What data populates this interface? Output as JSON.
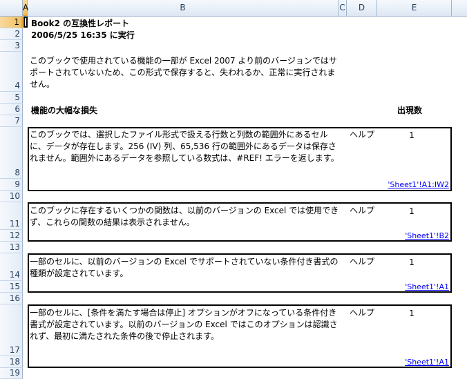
{
  "columns": [
    "A",
    "B",
    "C",
    "D",
    "E"
  ],
  "rows": [
    "1",
    "2",
    "3",
    "4",
    "5",
    "6",
    "7",
    "8",
    "9",
    "10",
    "11",
    "12",
    "13",
    "14",
    "15",
    "16",
    "17",
    "18",
    "19"
  ],
  "report": {
    "title": "Book2 の互換性レポート",
    "run_at": "2006/5/25 16:35 に実行",
    "intro": "このブックで使用されている機能の一部が Excel 2007 より前のバージョンではサポートされていないため、この形式で保存すると、失われるか、正常に実行されません。",
    "section_title": "機能の大幅な損失",
    "count_header": "出現数"
  },
  "issues": [
    {
      "desc": "このブックでは、選択したファイル形式で扱える行数と列数の範囲外にあるセルに、データが存在します。256 (IV) 列、65,536 行の範囲外にあるデータは保存されません。範囲外にあるデータを参照している数式は、#REF! エラーを返します。",
      "help": "ヘルプ",
      "count": "1",
      "link": "'Sheet1'!A1:IW2"
    },
    {
      "desc": "このブックに存在するいくつかの関数は、以前のバージョンの Excel では使用できず、これらの関数の結果は表示されません。",
      "help": "ヘルプ",
      "count": "1",
      "link": "'Sheet1'!B2"
    },
    {
      "desc": "一部のセルに、以前のバージョンの Excel でサポートされていない条件付き書式の種類が設定されています。",
      "help": "ヘルプ",
      "count": "1",
      "link": "'Sheet1'!A1"
    },
    {
      "desc": "一部のセルに、[条件を満たす場合は停止] オプションがオフになっている条件付き書式が設定されています。以前のバージョンの Excel ではこのオプションは認識されず、最初に満たされた条件の後で停止されます。",
      "help": "ヘルプ",
      "count": "1",
      "link": "'Sheet1'!A1"
    }
  ]
}
